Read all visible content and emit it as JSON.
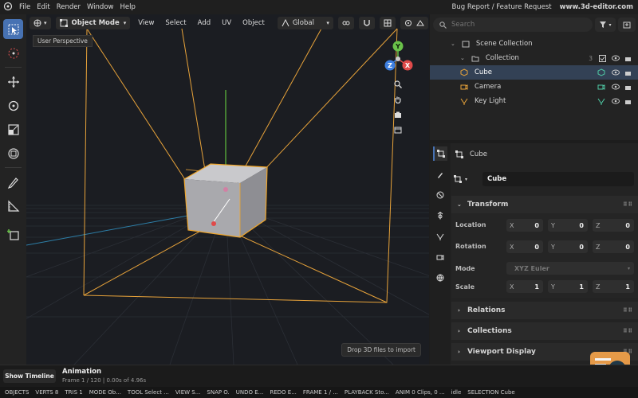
{
  "menubar": {
    "items": [
      "File",
      "Edit",
      "Render",
      "Window",
      "Help"
    ],
    "bug_report": "Bug Report / Feature Request",
    "site": "www.3d-editor.com"
  },
  "viewport": {
    "mode": "Object Mode",
    "menus": [
      "View",
      "Select",
      "Add",
      "UV",
      "Object"
    ],
    "orientation": "Global",
    "tooltip": "User Perspective",
    "drop_hint": "Drop 3D files to import",
    "gizmo": {
      "y": "Y",
      "z": "Z",
      "x": "X"
    }
  },
  "outliner": {
    "search_placeholder": "Search",
    "scene": "Scene Collection",
    "collection": "Collection",
    "collection_count": "3",
    "items": [
      "Cube",
      "Camera",
      "Key Light"
    ]
  },
  "properties": {
    "object_name": "Cube",
    "name_field": "Cube",
    "transform": {
      "title": "Transform",
      "location_label": "Location",
      "rotation_label": "Rotation",
      "mode_label": "Mode",
      "scale_label": "Scale",
      "axis": [
        "X",
        "Y",
        "Z"
      ],
      "location": [
        "0",
        "0",
        "0"
      ],
      "rotation": [
        "0",
        "0",
        "0"
      ],
      "scale": [
        "1",
        "1",
        "1"
      ],
      "mode": "XYZ Euler"
    },
    "relations": "Relations",
    "collections": "Collections",
    "viewport_display": "Viewport Display"
  },
  "timeline": {
    "button": "Show Timeline",
    "title": "Animation",
    "info": "Frame 1 / 120 | 0.00s of 4.96s"
  },
  "statusbar": [
    "OBJECTS",
    "VERTS 8",
    "TRIS 1",
    "MODE Ob...",
    "TOOL Select ...",
    "VIEW S...",
    "SNAP O.",
    "UNDO E...",
    "REDO E...",
    "FRAME 1 / ...",
    "PLAYBACK Sto...",
    "ANIM 0 Clips, 0 ...",
    "idle",
    "SELECTION Cube"
  ],
  "colors": {
    "accent": "#4772b3",
    "camera_lines": "#e8a33a",
    "axis_y": "#6ac24a",
    "axis_x": "#e04a4a",
    "axis_z": "#3d7fe0"
  }
}
